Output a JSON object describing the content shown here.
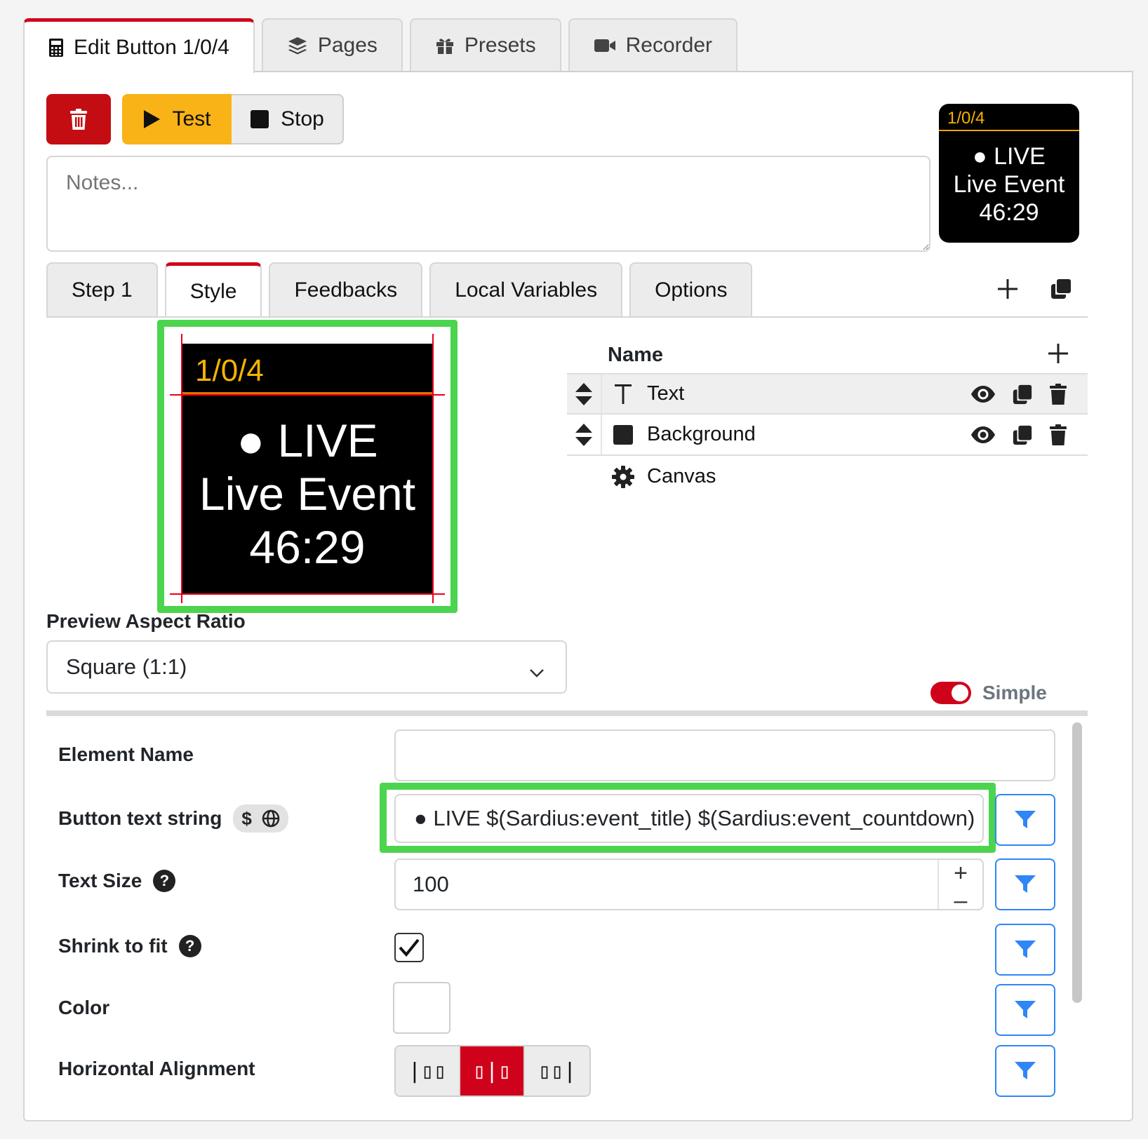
{
  "main_tabs": [
    {
      "label": "Edit Button 1/0/4",
      "icon": "calculator-icon",
      "active": true
    },
    {
      "label": "Pages",
      "icon": "layers-icon"
    },
    {
      "label": "Presets",
      "icon": "gift-icon"
    },
    {
      "label": "Recorder",
      "icon": "video-icon"
    }
  ],
  "toolbar": {
    "test_label": "Test",
    "stop_label": "Stop"
  },
  "notes": {
    "placeholder": "Notes..."
  },
  "mini_preview": {
    "header": "1/0/4",
    "line1": "● LIVE",
    "line2": "Live Event",
    "line3": "46:29"
  },
  "sub_tabs": [
    "Step 1",
    "Style",
    "Feedbacks",
    "Local Variables",
    "Options"
  ],
  "big_preview": {
    "header": "1/0/4",
    "line1": "● LIVE",
    "line2": "Live Event",
    "line3": "46:29"
  },
  "elements": {
    "header": "Name",
    "rows": [
      {
        "label": "Text",
        "icon": "text-type-icon"
      },
      {
        "label": "Background",
        "icon": "square-icon"
      },
      {
        "label": "Canvas",
        "icon": "gear-icon"
      }
    ]
  },
  "aspect": {
    "label": "Preview Aspect Ratio",
    "value": "Square (1:1)"
  },
  "mode_toggle": {
    "label": "Simple",
    "on": true
  },
  "form": {
    "element_name": {
      "label": "Element Name",
      "value": ""
    },
    "button_text": {
      "label": "Button text string",
      "value": "● LIVE $(Sardius:event_title) $(Sardius:event_countdown)"
    },
    "text_size": {
      "label": "Text Size",
      "value": "100"
    },
    "shrink": {
      "label": "Shrink to fit",
      "checked": true
    },
    "color": {
      "label": "Color",
      "value": "#ffffff"
    },
    "halign": {
      "label": "Horizontal Alignment",
      "options": [
        "|▯▯",
        "▯|▯",
        "▯▯|"
      ],
      "selected": 1
    }
  },
  "colors": {
    "accent": "#d0021b",
    "test": "#f9b316",
    "highlight": "#4cd44f",
    "filter": "#2f86f6"
  }
}
